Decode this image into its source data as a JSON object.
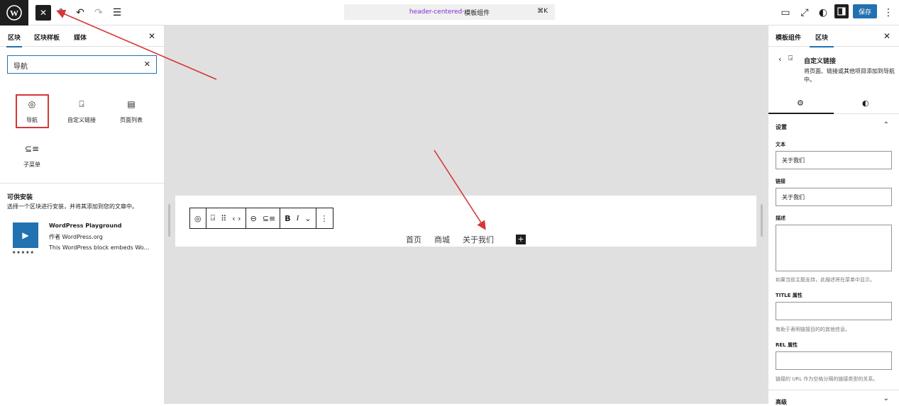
{
  "topbar": {
    "logo_icon": "wordpress-logo-icon",
    "close_label": "✕",
    "command": {
      "slug": "header-centered",
      "separator": " · ",
      "type": "模板组件",
      "shortcut": "⌘K"
    },
    "save_label": "保存"
  },
  "left_panel": {
    "tabs": [
      "区块",
      "区块样板",
      "媒体"
    ],
    "search_value": "导航",
    "blocks": [
      {
        "label": "导航",
        "icon": "◎"
      },
      {
        "label": "自定义链接",
        "icon": "⍈"
      },
      {
        "label": "页面列表",
        "icon": "▤"
      },
      {
        "label": "子菜单",
        "icon": "⊆≡"
      }
    ],
    "available_title": "可供安装",
    "available_desc": "选择一个区块进行安装，并将其添加到您的文章中。",
    "plugin": {
      "title": "WordPress Playground",
      "author": "作者 WordPress.org",
      "desc": "This WordPress block embeds Wo...",
      "stars": "★★★★★"
    }
  },
  "canvas": {
    "nav_items": [
      "首页",
      "商城",
      "关于我们"
    ],
    "plus": "+"
  },
  "right_panel": {
    "tabs": [
      "模板组件",
      "区块"
    ],
    "block_title": "自定义链接",
    "block_desc": "将页面、链接或其他项目添加到导航中。",
    "settings_label": "设置",
    "text_label": "文本",
    "text_value": "关于我们",
    "link_label": "链接",
    "link_value": "关于我们",
    "desc_label": "描述",
    "desc_hint": "如果当前主题支持，此描述将在菜单中显示。",
    "title_attr_label": "TITLE 属性",
    "title_attr_hint": "有助于表明链接目的的其他信息。",
    "rel_label": "REL 属性",
    "rel_hint": "链接的 URL 作为空格分隔的链接类型的关系。",
    "advanced_label": "高级"
  },
  "colors": {
    "accent": "#2271b1",
    "annotation": "#d63638",
    "dark": "#1e1e1e"
  }
}
